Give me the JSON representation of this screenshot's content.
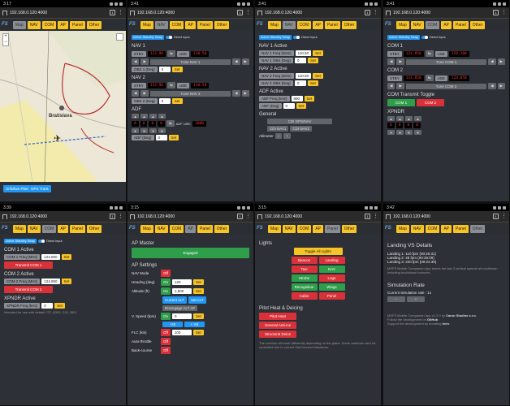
{
  "url": "192.168.0.120:4000",
  "logo": "FS",
  "nav": [
    "Map",
    "NAV",
    "COM",
    "AP",
    "Panel",
    "Other"
  ],
  "phones": [
    {
      "time": "3:17",
      "active": "Map"
    },
    {
      "time": "3:41",
      "active": "NAV"
    },
    {
      "time": "3:41",
      "active": "NAV"
    },
    {
      "time": "3:41",
      "active": "COM"
    },
    {
      "time": "3:39",
      "active": "COM"
    },
    {
      "time": "3:15",
      "active": "AP"
    },
    {
      "time": "3:15",
      "active": "Panel"
    },
    {
      "time": "3:42",
      "active": "Other"
    }
  ],
  "toggle": {
    "left": "Active-Standby Swap",
    "right": "Direct Input"
  },
  "map": {
    "city": "Bratislava",
    "btn1": "Unfollow Plane",
    "btn2": "GPS Track"
  },
  "nav1": {
    "nav1": "NAV 1",
    "stby": "STBY",
    "freq1": "113.90",
    "use": "USE",
    "freq2": "110.50",
    "tune": "Tune NAV 1",
    "obs": "OBS 1 (Deg)",
    "obs_val": "0",
    "set": "Set",
    "nav2": "NAV 2",
    "freq3": "113.90",
    "freq4": "110.50",
    "tune2": "Tune NAV 2",
    "obs2": "OBS 2 (Deg)",
    "adf": "ADF",
    "adf_use": "ADF USE:",
    "adf_digits": [
      "0",
      "0",
      "0",
      "0"
    ],
    "adf_use_val": "1000",
    "adf_deg": "ADF (Deg)"
  },
  "nav2p": {
    "nav1a": "NAV 1 Active",
    "f1": "NAV 1 Freq (MHz)",
    "f1v": "110.50",
    "o1": "NAV 1 OBS (Deg)",
    "o1v": "0",
    "nav2a": "NAV 2 Active",
    "f2": "NAV 2 Freq (MHz)",
    "f2v": "110.50",
    "o2": "NAV 2 OBS (Deg)",
    "o2v": "0",
    "adfa": "ADF Active",
    "af": "ADF Freq (kHz)",
    "afv": "890",
    "ad": "ADF (Deg)",
    "adv": "0",
    "gen": "General",
    "cdi": "CDI GPS/NAV",
    "cdin1": "CDI NAV1",
    "cdin2": "CDI NAV2",
    "alt": "Altimeter"
  },
  "com1": {
    "com1": "COM 1",
    "stby": "STBY",
    "f1": "124.850",
    "use": "USE",
    "f2": "118.200",
    "tune": "Tune COM 1",
    "com2": "COM 2",
    "f3": "124.850",
    "f4": "124.850",
    "tune2": "Tune COM 2",
    "ctt": "COM Transmit Toggle",
    "c1": "COM 1",
    "c2": "COM 2",
    "xpndr": "XPNDR",
    "xd": [
      "0",
      "0",
      "0",
      "0"
    ]
  },
  "com2p": {
    "c1a": "COM 1 Active",
    "c1f": "COM 1 Freq (MHz)",
    "c1v": "124.850",
    "t1": "Transmit COM 1",
    "c2a": "COM 2 Active",
    "c2f": "COM 2 Freq (MHz)",
    "c2v": "124.850",
    "t2": "Transmit COM 2",
    "xa": "XPNDR Active",
    "xf": "XPNDR Freq (kHz)",
    "xv": "0",
    "note": "Intended for use with default 707, A320, CJ4, 350i."
  },
  "ap": {
    "master": "AP Master",
    "engaged": "Engaged",
    "settings": "AP Settings",
    "navmode": "NAV Mode",
    "off": "Off",
    "heading": "Heading (deg)",
    "on": "On",
    "hv": "120",
    "altitude": "Altitude (ft)",
    "av": "1,500",
    "cur": "Current ALT",
    "setalt": "Set ALT",
    "disengage": "Disengage ALT AP",
    "vs": "V. Speed (fpm)",
    "vsv": "0",
    "m": "-VS",
    "p": "+ VS",
    "flc": "FLC (kts)",
    "flcv": "100",
    "athr": "Auto-throttle",
    "bc": "Back-course"
  },
  "panel": {
    "lights": "Lights",
    "toggle": "Toggle All Lights",
    "items": [
      [
        "Beacon",
        "Landing"
      ],
      [
        "Taxi",
        "NAV"
      ],
      [
        "Strobe",
        "Logo"
      ],
      [
        "Recognition",
        "Wings"
      ],
      [
        "Cabin",
        "Panel"
      ]
    ],
    "pitot": "Pitot Heat & Deicing",
    "ph": "Pitot Heat",
    "gai": "General Anti-Ice",
    "sd": "Structural Deice",
    "note": "The controls will work differently depending on the plane. Some switches can't be controlled due to current SimConnect limitations."
  },
  "other": {
    "lvs": "Landing VS Details",
    "l1": "Landing 1: 110 fpm (00:25:31)",
    "l2": "Landing 2: 48 fpm (00:25:09)",
    "l3": "Landing 3: 220 fpm (00:24:38)",
    "note1": "MSFS Mobile Companion App stores the last 3 vertical speeds at touchdown including touchdown bounces.",
    "simrate": "Simulation Rate",
    "cur": "Current simulation rate : 1x",
    "note2": "MSFS Mobile Companion App v1.2.0 by",
    "author": "Caron Studios s.r.o.",
    "follow": "Follow the development on",
    "gh": "GitHub",
    "support": "Support the development by donating",
    "here": "here."
  }
}
